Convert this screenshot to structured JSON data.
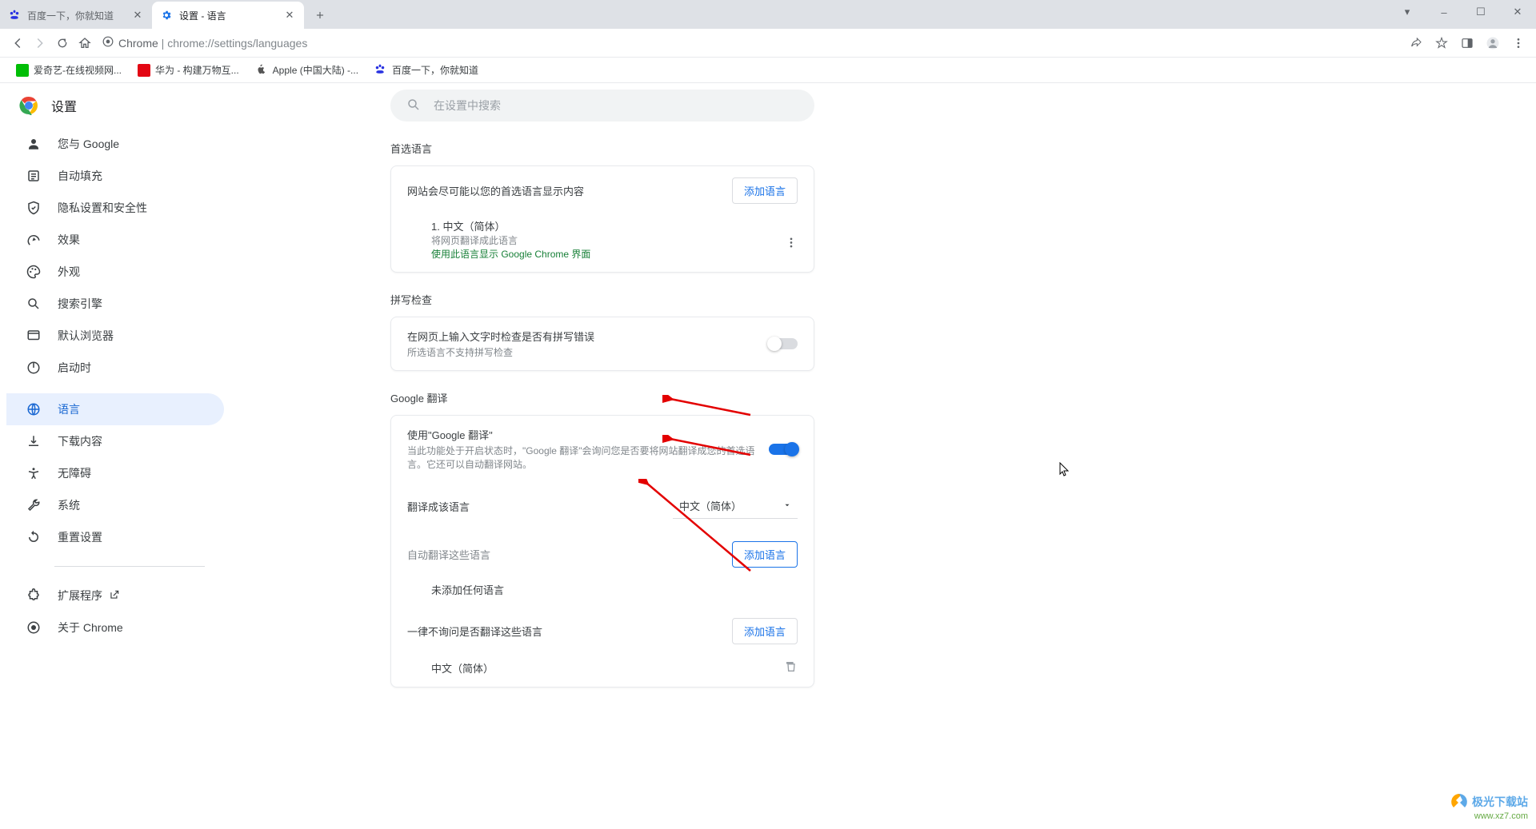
{
  "tabs": [
    {
      "title": "百度一下，你就知道",
      "active": false
    },
    {
      "title": "设置 - 语言",
      "active": true
    }
  ],
  "window_controls": {
    "min": "–",
    "max": "☐",
    "close": "✕",
    "dropdown": "▾"
  },
  "address": {
    "prefix": "Chrome",
    "url": "chrome://settings/languages"
  },
  "bookmarks": [
    {
      "label": "爱奇艺-在线视频网...",
      "color": "#00be06"
    },
    {
      "label": "华为 - 构建万物互...",
      "color": "#e30613"
    },
    {
      "label": "Apple (中国大陆) -...",
      "color": "#555"
    },
    {
      "label": "百度一下，你就知道",
      "color": "#2932e1"
    }
  ],
  "settings_label": "设置",
  "search_placeholder": "在设置中搜索",
  "nav": [
    {
      "icon": "person-icon",
      "label": "您与 Google"
    },
    {
      "icon": "autofill-icon",
      "label": "自动填充"
    },
    {
      "icon": "shield-icon",
      "label": "隐私设置和安全性"
    },
    {
      "icon": "speed-icon",
      "label": "效果"
    },
    {
      "icon": "palette-icon",
      "label": "外观"
    },
    {
      "icon": "search-icon",
      "label": "搜索引擎"
    },
    {
      "icon": "browser-icon",
      "label": "默认浏览器"
    },
    {
      "icon": "power-icon",
      "label": "启动时"
    },
    {
      "icon": "globe-icon",
      "label": "语言",
      "active": true
    },
    {
      "icon": "download-icon",
      "label": "下载内容"
    },
    {
      "icon": "accessibility-icon",
      "label": "无障碍"
    },
    {
      "icon": "wrench-icon",
      "label": "系统"
    },
    {
      "icon": "reset-icon",
      "label": "重置设置"
    }
  ],
  "nav_footer": [
    {
      "icon": "extension-icon",
      "label": "扩展程序",
      "external": true
    },
    {
      "icon": "about-icon",
      "label": "关于 Chrome"
    }
  ],
  "sections": {
    "preferred": {
      "title": "首选语言",
      "desc": "网站会尽可能以您的首选语言显示内容",
      "add_btn": "添加语言",
      "lang_num": "1.",
      "lang_name": "中文（简体）",
      "lang_sub": "将网页翻译成此语言",
      "lang_green": "使用此语言显示 Google Chrome 界面"
    },
    "spellcheck": {
      "title": "拼写检查",
      "desc": "在网页上输入文字时检查是否有拼写错误",
      "sub": "所选语言不支持拼写检查"
    },
    "translate": {
      "title": "Google 翻译",
      "use_label": "使用\"Google 翻译\"",
      "use_desc": "当此功能处于开启状态时，\"Google 翻译\"会询问您是否要将网站翻译成您的首选语言。它还可以自动翻译网站。",
      "target_label": "翻译成该语言",
      "target_value": "中文（简体）",
      "auto_label": "自动翻译这些语言",
      "auto_add": "添加语言",
      "auto_empty": "未添加任何语言",
      "never_label": "一律不询问是否翻译这些语言",
      "never_add": "添加语言",
      "never_lang": "中文（简体）"
    }
  },
  "watermark": {
    "line1": "极光下载站",
    "line2": "www.xz7.com"
  }
}
